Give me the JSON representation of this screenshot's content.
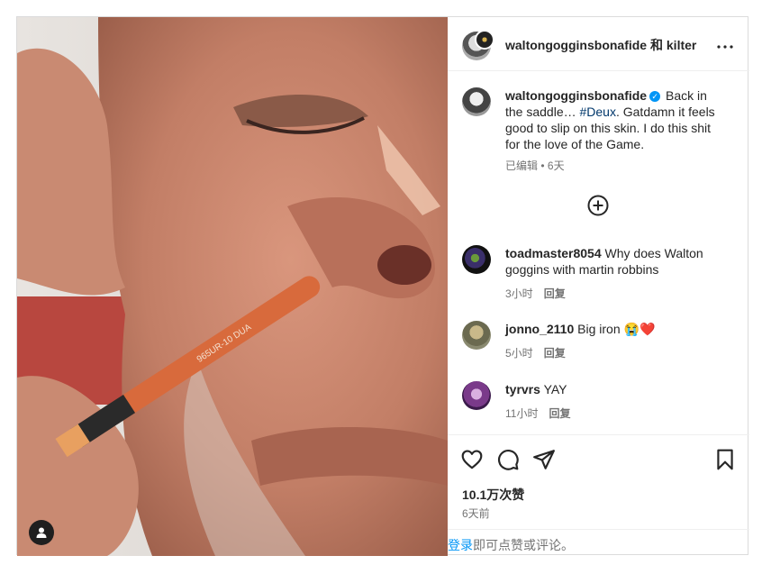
{
  "header": {
    "username": "waltongogginsbonafide",
    "and_text": "和",
    "collaborator": "kilter",
    "more_icon": "more-horizontal-icon"
  },
  "caption": {
    "username": "waltongogginsbonafide",
    "text_before_tag": "Back in the saddle… ",
    "hashtag": "#Deux",
    "text_after_tag": ". Gatdamn it feels good to slip on this skin. I do this shit for the love of the Game.",
    "edited": "已编辑",
    "separator": " • ",
    "time": "6天"
  },
  "comments": [
    {
      "username": "toadmaster8054",
      "text": "Why does Walton goggins with martin robbins",
      "time": "3小时",
      "reply": "回复"
    },
    {
      "username": "jonno_2110",
      "text": "Big iron 😭❤️",
      "time": "5小时",
      "reply": "回复"
    },
    {
      "username": "tyrvrs",
      "text": "YAY",
      "time": "11小时",
      "reply": "回复"
    }
  ],
  "likes": "10.1万次赞",
  "post_date": "6天前",
  "login_prompt": {
    "link": "登录",
    "rest": "即可点赞或评论。"
  },
  "photo": {
    "pencil_text": "965UR-10 DUA"
  },
  "colors": {
    "link_blue": "#0095f6",
    "hashtag_blue": "#00376b",
    "verified_blue": "#0095f6",
    "muted": "#737373"
  }
}
